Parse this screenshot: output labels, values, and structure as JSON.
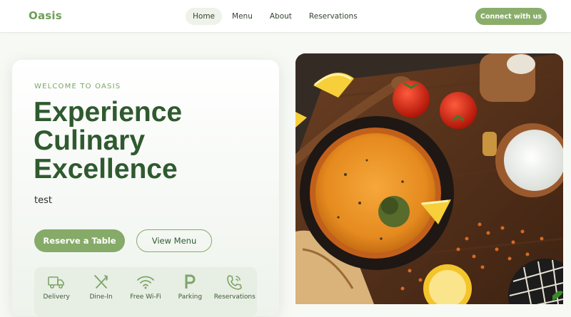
{
  "nav": {
    "logo": "Oasis",
    "links": [
      "Home",
      "Menu",
      "About",
      "Reservations"
    ],
    "active": "Home",
    "cta": "Connect with us"
  },
  "hero": {
    "eyebrow": "WELCOME TO OASIS",
    "headline": [
      "Experience",
      "Culinary",
      "Excellence"
    ],
    "tagline": "test",
    "primary_button": "Reserve a Table",
    "secondary_button": "View Menu"
  },
  "features": [
    {
      "icon": "truck-icon",
      "label": "Delivery"
    },
    {
      "icon": "fork-knife-icon",
      "label": "Dine-In"
    },
    {
      "icon": "wifi-icon",
      "label": "Free Wi-Fi"
    },
    {
      "icon": "parking-icon",
      "label": "Parking"
    },
    {
      "icon": "phone-icon",
      "label": "Reservations"
    }
  ],
  "colors": {
    "brand": "#6f9e57",
    "button": "#86aa68",
    "heading": "#2f5a2f"
  }
}
